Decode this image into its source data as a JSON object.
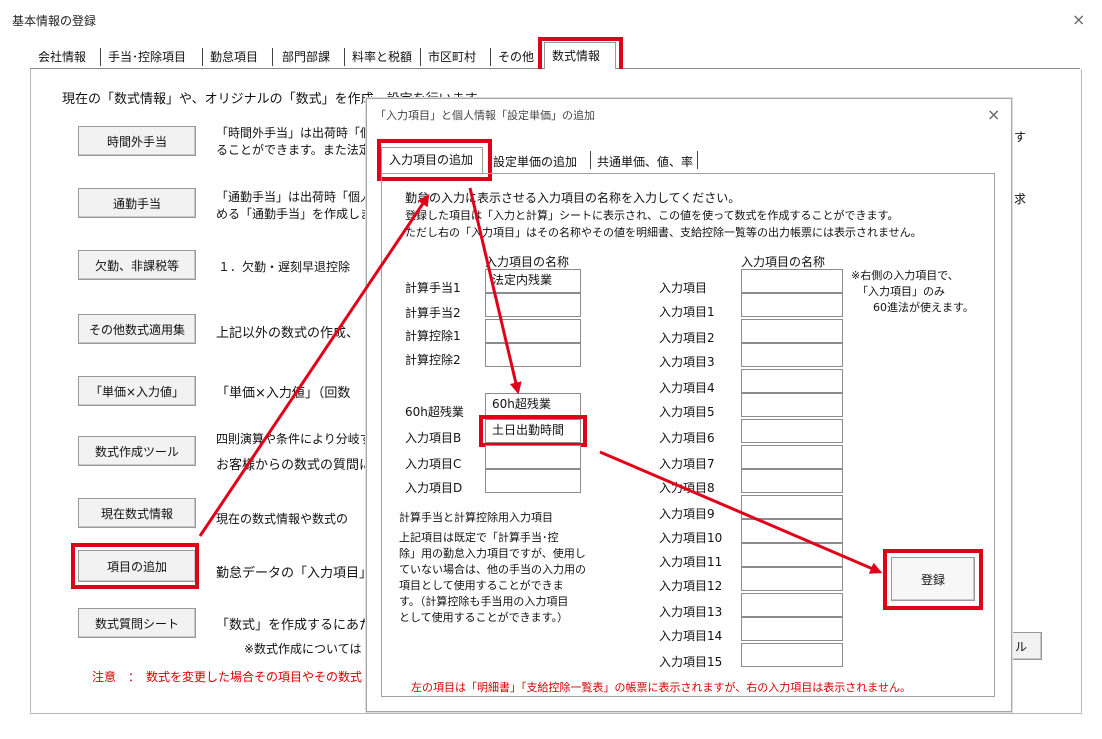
{
  "window": {
    "title": "基本情報の登録",
    "close": "×"
  },
  "tabs": [
    "会社情報",
    "手当･控除項目",
    "勤怠項目",
    "部門部課",
    "料率と税額",
    "市区町村",
    "その他",
    "数式情報"
  ],
  "main": {
    "intro": "現在の「数式情報」や、オリジナルの「数式」を作成、設定を行います。",
    "buttons": [
      "時間外手当",
      "通勤手当",
      "欠勤、非課税等",
      "その他数式適用集",
      "「単価×入力値」",
      "数式作成ツール",
      "現在数式情報",
      "項目の追加",
      "数式質問シート"
    ],
    "desc_overtime_1": "「時間外手当」は出荷時「個",
    "desc_overtime_2": "ることができます。また法定外",
    "desc_commute_1": "「通勤手当」は出荷時「個人",
    "desc_commute_2": "める「通勤手当」を作成します",
    "desc_absence": "１．欠勤・遅刻早退控除",
    "desc_other": "上記以外の数式の作成、",
    "desc_unit": "「単価×入力値」（回数",
    "desc_tool_1": "四則演算や条件により分岐す",
    "desc_tool_2": "お客様からの数式の質問に",
    "desc_current": "現在の数式情報や数式の",
    "desc_add": "勤怠データの「入力項目」、",
    "desc_question": "「数式」を作成するにあたり",
    "note_formula": "※数式作成については",
    "right_frag_1": "す",
    "right_frag_2": "求",
    "right_frag_3": "ル",
    "caution": "注意　：　数式を変更した場合その項目やその数式"
  },
  "dialog": {
    "title": "「入力項目」と個人情報「設定単価」の追加",
    "close": "×",
    "tabs": [
      "入力項目の追加",
      "設定単価の追加",
      "共通単価、値、率"
    ],
    "instr_1": "勤怠の入力に表示させる入力項目の名称を入力してください。",
    "instr_2": "登録した項目は「入力と計算」シートに表示され、この値を使って数式を作成することができます。",
    "instr_3": "ただし右の「入力項目」はその名称やその値を明細書、支給控除一覧等の出力帳票には表示されません。",
    "left_header": "入力項目の名称",
    "right_header": "入力項目の名称",
    "left_rows": [
      {
        "label": "計算手当1",
        "value": "法定内残業"
      },
      {
        "label": "計算手当2",
        "value": ""
      },
      {
        "label": "計算控除1",
        "value": ""
      },
      {
        "label": "計算控除2",
        "value": ""
      },
      {
        "label": "60h超残業",
        "value": "60h超残業"
      },
      {
        "label": "入力項目B",
        "value": "土日出勤時間"
      },
      {
        "label": "入力項目C",
        "value": ""
      },
      {
        "label": "入力項目D",
        "value": ""
      }
    ],
    "right_labels": [
      "入力項目",
      "入力項目1",
      "入力項目2",
      "入力項目3",
      "入力項目4",
      "入力項目5",
      "入力項目6",
      "入力項目7",
      "入力項目8",
      "入力項目9",
      "入力項目10",
      "入力項目11",
      "入力項目12",
      "入力項目13",
      "入力項目14",
      "入力項目15"
    ],
    "note_right_1": "※右側の入力項目で、",
    "note_right_2": "「入力項目」のみ",
    "note_right_3": "60進法が使えます。",
    "calc_title": "計算手当と計算控除用入力項目",
    "calc_desc_1": "上記項目は既定で「計算手当･控",
    "calc_desc_2": "除」用の勤怠入力項目ですが、使用し",
    "calc_desc_3": "ていない場合は、他の手当の入力用の",
    "calc_desc_4": "項目として使用することができま",
    "calc_desc_5": "す。（計算控除も手当用の入力項目",
    "calc_desc_6": "として使用することができます。）",
    "register": "登録",
    "footer": "左の項目は「明細書」「支給控除一覧表」の帳票に表示されますが、右の入力項目は表示されません。"
  },
  "colors": {
    "highlight": "#e0001a",
    "caution_text": "#d40000"
  }
}
